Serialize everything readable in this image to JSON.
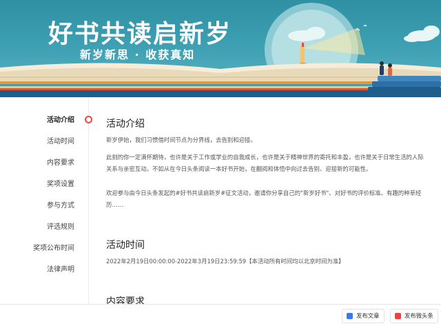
{
  "banner": {
    "title": "好书共读启新岁",
    "subtitle": "新岁新思 · 收获真知"
  },
  "nav": {
    "items": [
      "活动介绍",
      "活动时间",
      "内容要求",
      "奖项设置",
      "参与方式",
      "评选规则",
      "奖项公布时间",
      "法律声明"
    ],
    "active_index": 0
  },
  "sections": {
    "intro": {
      "title": "活动介绍",
      "paragraphs": [
        "新岁伊始，我们习惯借时间节点为分界线，去告别和迎接。",
        "此刻的你一定满怀期待，也许是关于工作或学业的自我成长，也许是关于精神世界的寄托和丰盈，也许是关于日常生活的人际关系与亲密互动。不如从在今日头条阅读一本好书开始，在翻阅和体悟中向过去告别、迎接新的可能性。",
        "欢迎参与由今日头条发起的#好书共读启新岁#征文活动，邀请你分享自己的\"新岁好书\"、对好书的评价标准、有趣的种草经历……"
      ]
    },
    "time": {
      "title": "活动时间",
      "text": "2022年2月19日00:00:00-2022年3月19日23:59:59【本活动所有时间均以北京时间为准】"
    },
    "requirements": {
      "title": "内容要求"
    }
  },
  "bottom": {
    "publish_article": "发布文章",
    "publish_micro": "发布微头条"
  },
  "colors": {
    "accent_red": "#f04142",
    "banner_teal": "#3d9fb2",
    "article_icon": "#3a78f2"
  }
}
